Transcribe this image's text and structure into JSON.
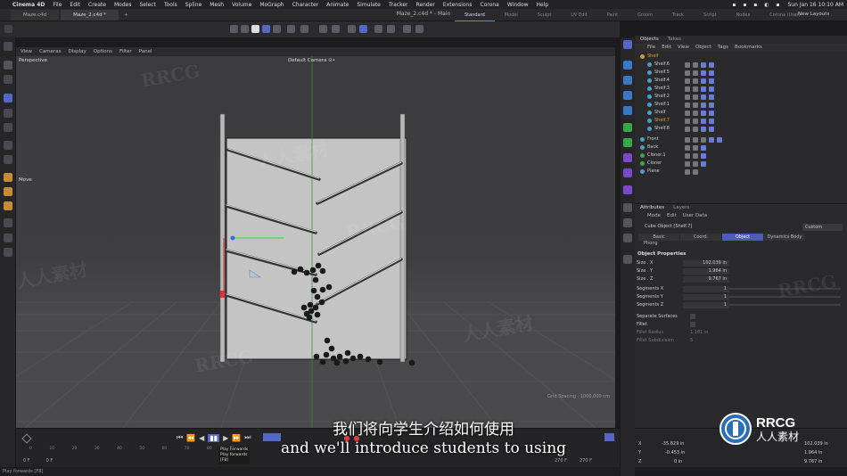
{
  "menubar": {
    "app": "Cinema 4D",
    "items": [
      "File",
      "Edit",
      "Create",
      "Modes",
      "Select",
      "Tools",
      "Spline",
      "Mesh",
      "Volume",
      "MoGraph",
      "Character",
      "Animate",
      "Simulate",
      "Tracker",
      "Render",
      "Extensions",
      "Corona",
      "Window",
      "Help"
    ],
    "datetime": "Sun Jan 16  10:10 AM"
  },
  "doctabs": [
    "Maze.c4d",
    "Maze_2.c4d *"
  ],
  "window_title": "Maze_2.c4d * - Main",
  "layouts": [
    "Standard",
    "Model",
    "Sculpt",
    "UV Edit",
    "Paint",
    "Groom",
    "Track",
    "Script",
    "Nodes",
    "Corona (User)"
  ],
  "new_layouts": "New Layouts",
  "viewport": {
    "menu": [
      "View",
      "Cameras",
      "Display",
      "Options",
      "Filter",
      "Panel"
    ],
    "label": "Perspective",
    "camera": "Default Camera ⊙•",
    "move_label": "Move",
    "grid_spacing": "Grid Spacing : 1000.000 cm"
  },
  "object_manager": {
    "tabs": [
      "Objects",
      "Takes"
    ],
    "menu": [
      "File",
      "Edit",
      "View",
      "Object",
      "Tags",
      "Bookmarks"
    ],
    "objects": [
      {
        "name": "Shelf",
        "highlight": true
      },
      {
        "name": "Shelf.6",
        "highlight": false
      },
      {
        "name": "Shelf.5",
        "highlight": false
      },
      {
        "name": "Shelf.4",
        "highlight": false
      },
      {
        "name": "Shelf.3",
        "highlight": false
      },
      {
        "name": "Shelf.2",
        "highlight": false
      },
      {
        "name": "Shelf.1",
        "highlight": false
      },
      {
        "name": "Shelf",
        "highlight": false
      },
      {
        "name": "Shelf.7",
        "highlight": true
      },
      {
        "name": "Shelf.8",
        "highlight": false
      },
      {
        "name": "Front",
        "highlight": false
      },
      {
        "name": "Back",
        "highlight": false
      },
      {
        "name": "Cloner.1",
        "highlight": false
      },
      {
        "name": "Cloner",
        "highlight": false
      },
      {
        "name": "Plane",
        "highlight": false
      }
    ]
  },
  "attributes": {
    "tabs": [
      "Attributes",
      "Layers"
    ],
    "menu": [
      "Mode",
      "Edit",
      "User Data"
    ],
    "title": "Cube Object [Shelf.7]",
    "preset": "Custom",
    "subtabs": [
      "Basic",
      "Coord.",
      "Object",
      "Dynamics Body"
    ],
    "active_subtab": "Object",
    "phong": "Phong",
    "section": "Object Properties",
    "props": [
      {
        "label": "Size . X",
        "value": "102.039 in"
      },
      {
        "label": "Size . Y",
        "value": "1.964 in"
      },
      {
        "label": "Size . Z",
        "value": "9.767 in"
      },
      {
        "label": "Segments X",
        "value": "1"
      },
      {
        "label": "Segments Y",
        "value": "1"
      },
      {
        "label": "Segments Z",
        "value": "1"
      }
    ],
    "separate_surfaces": "Separate Surfaces",
    "fillet": "Fillet",
    "fillet_radius": "Fillet Radius",
    "fillet_radius_value": "1.181 in",
    "fillet_subdivision": "Fillet Subdivision",
    "fillet_subdivision_value": "5"
  },
  "timeline": {
    "ticks": [
      "0",
      "10",
      "20",
      "30",
      "40",
      "50",
      "60",
      "70",
      "80",
      "90"
    ],
    "frame_start": "0 F",
    "frame_current": "0 F",
    "frame_end_a": "270 F",
    "frame_end_b": "270 F"
  },
  "tooltip": {
    "title": "Play Forwards",
    "line1": "Play forwards",
    "line2": "[F8]"
  },
  "coords": {
    "x_label": "X",
    "x_value": "-35.829 in",
    "x2": "102.039 in",
    "y_label": "Y",
    "y_value": "-0.453 in",
    "y2": "1.964 in",
    "z_label": "Z",
    "z_value": "0 in",
    "z2": "9.767 in"
  },
  "status": "Play forwards [F8]",
  "subtitle_cn": "我们将向学生介绍如何使用",
  "subtitle_en": "and we'll introduce students to using",
  "logo": {
    "name": "RRCG",
    "sub": "人人素材"
  },
  "watermark": "RRCG",
  "watermark_cn": "人人素材"
}
